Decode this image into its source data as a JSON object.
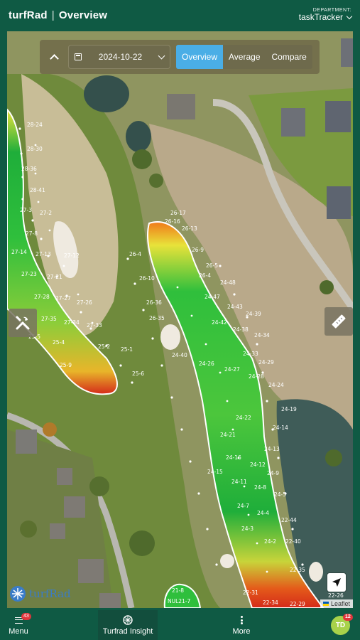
{
  "header": {
    "app_name": "turfRad",
    "separator": "|",
    "page_title": "Overview",
    "department_label": "DEPARTMENT:",
    "department_value": "taskTracker"
  },
  "toolbar": {
    "date": "2024-10-22",
    "views": [
      "Overview",
      "Average",
      "Compare"
    ],
    "active_view": "Overview"
  },
  "map": {
    "logo_text": "turfRad",
    "attribution": "Leaflet",
    "hole_labels": [
      "28-24",
      "28-30",
      "28-36",
      "28-41",
      "27-3",
      "27-2",
      "27-8",
      "27-14",
      "27-13",
      "27-12",
      "27-23",
      "27-21",
      "27-28",
      "27-27",
      "27-26",
      "27-35",
      "27-34",
      "27-33",
      "25-5",
      "25-4",
      "25-9",
      "25-2",
      "25-1",
      "25-6",
      "26-17",
      "26-16",
      "26-13",
      "26-4",
      "26-9",
      "26-10",
      "26-5",
      "26-4",
      "26-35",
      "26-36",
      "24-48",
      "24-47",
      "24-43",
      "24-42",
      "24-39",
      "24-38",
      "24-34",
      "24-40",
      "24-33",
      "24-28",
      "24-29",
      "24-26",
      "24-27",
      "24-24",
      "24-19",
      "24-22",
      "24-14",
      "24-21",
      "24-16",
      "24-13",
      "24-12",
      "24-15",
      "24-11",
      "24-9",
      "24-7",
      "24-8",
      "24-5",
      "24-4",
      "24-3",
      "24-2",
      "22-44",
      "22-40",
      "22-35",
      "22-26",
      "22-31",
      "22-34",
      "22-29",
      "21-8",
      "NUL21-7"
    ]
  },
  "nav": {
    "menu_label": "Menu",
    "menu_badge": "43",
    "insight_label": "Turfrad Insight",
    "more_label": "More",
    "avatar_initials": "TD",
    "avatar_badge": "12"
  },
  "colors": {
    "brand_green": "#0f5a44",
    "active_blue": "#4aaee6",
    "heat_low": "#1fae3a",
    "heat_mid": "#e8e23a",
    "heat_high": "#d42a1a"
  }
}
